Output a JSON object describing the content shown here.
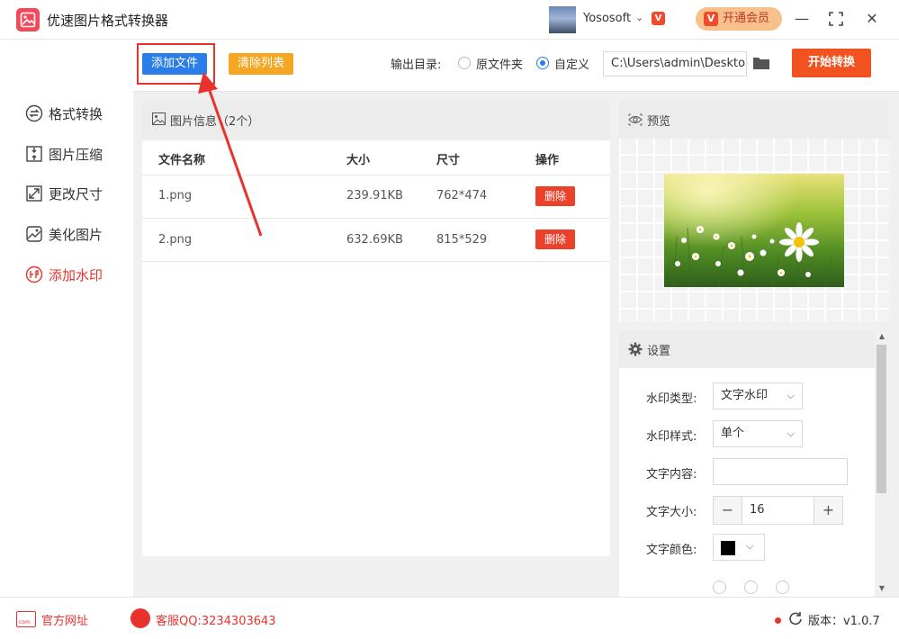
{
  "app": {
    "title": "优速图片格式转换器",
    "user_name": "Yososoft",
    "vip_label": "开通会员",
    "vip_badge": "V"
  },
  "toolbar": {
    "add_file": "添加文件",
    "clear_list": "清除列表",
    "output_label": "输出目录:",
    "option_original": "原文件夹",
    "option_custom": "自定义",
    "selected_option": "自定义",
    "output_path": "C:\\Users\\admin\\Deskto",
    "start": "开始转换"
  },
  "sidebar": {
    "items": [
      {
        "label": "格式转换",
        "icon": "convert-icon",
        "active": false
      },
      {
        "label": "图片压缩",
        "icon": "compress-icon",
        "active": false
      },
      {
        "label": "更改尺寸",
        "icon": "resize-icon",
        "active": false
      },
      {
        "label": "美化图片",
        "icon": "beautify-icon",
        "active": false
      },
      {
        "label": "添加水印",
        "icon": "watermark-icon",
        "active": true
      }
    ]
  },
  "file_panel": {
    "title": "图片信息（2个）",
    "columns": [
      "文件名称",
      "大小",
      "尺寸",
      "操作"
    ],
    "rows": [
      {
        "name": "1.png",
        "size": "239.91KB",
        "dimensions": "762*474",
        "action": "删除"
      },
      {
        "name": "2.png",
        "size": "632.69KB",
        "dimensions": "815*529",
        "action": "删除"
      }
    ]
  },
  "preview": {
    "title": "预览"
  },
  "settings": {
    "title": "设置",
    "watermark_type_label": "水印类型:",
    "watermark_type_value": "文字水印",
    "watermark_style_label": "水印样式:",
    "watermark_style_value": "单个",
    "text_content_label": "文字内容:",
    "text_content_value": "",
    "text_size_label": "文字大小:",
    "text_size_value": "16",
    "text_color_label": "文字颜色:",
    "text_color_value": "#000000"
  },
  "footer": {
    "site_icon_text": "com",
    "site_link": "官方网址",
    "qq": "客服QQ:3234303643",
    "version": "版本：v1.0.7"
  },
  "colors": {
    "accent_red": "#e9322d",
    "primary_blue": "#2b7de9",
    "orange": "#f5a623",
    "start_orange": "#f2521f"
  }
}
